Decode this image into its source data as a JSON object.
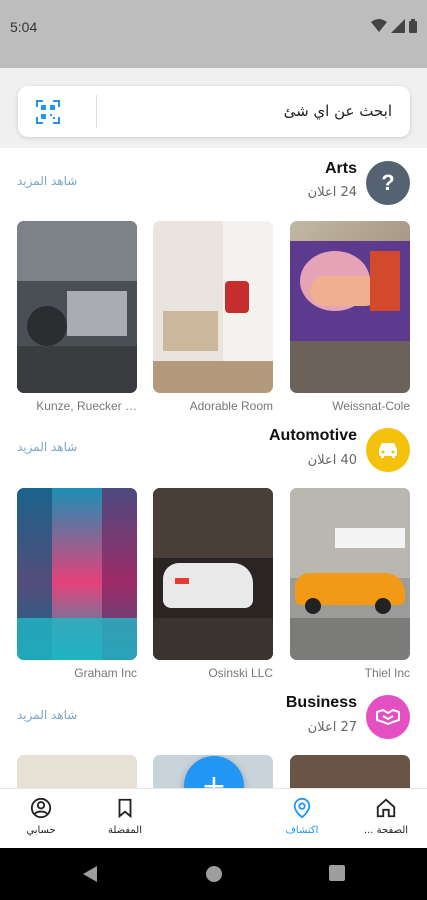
{
  "status_bar": {
    "time": "5:04"
  },
  "search": {
    "placeholder": "ابحث عن اي شئ"
  },
  "sections": [
    {
      "title": "Arts",
      "count": "24 اعلان",
      "more": "شاهد المزيد",
      "icon": "question-icon",
      "icon_color": "#546271",
      "cards": [
        "Weissnat-Cole",
        "Adorable Room",
        "Kunze, Ruecker …"
      ]
    },
    {
      "title": "Automotive",
      "count": "40 اعلان",
      "more": "شاهد المزيد",
      "icon": "car-icon",
      "icon_color": "#f4c20d",
      "cards": [
        "Thiel Inc",
        "Osinski LLC",
        "Graham Inc"
      ]
    },
    {
      "title": "Business",
      "count": "27 اعلان",
      "more": "شاهد المزيد",
      "icon": "handshake-icon",
      "icon_color": "#e44fc2",
      "cards": [
        "",
        "",
        ""
      ]
    }
  ],
  "bottom_nav": {
    "home": "الصفحة ...",
    "discover": "اكتشاف",
    "favorites": "المفضلة",
    "account": "حسابي",
    "active_color": "#2196f3"
  },
  "fab": {
    "label": "+"
  }
}
